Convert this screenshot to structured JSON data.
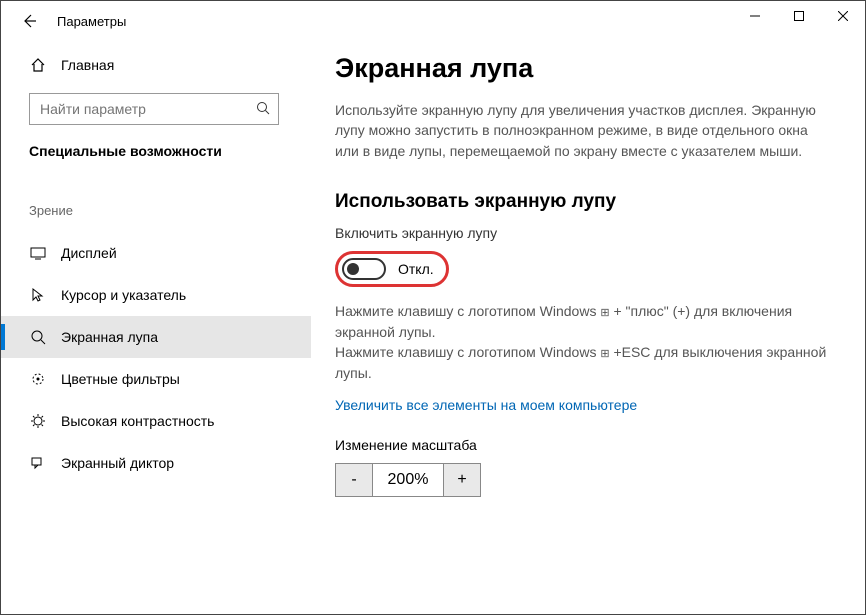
{
  "window": {
    "title": "Параметры"
  },
  "sidebar": {
    "home": "Главная",
    "search_placeholder": "Найти параметр",
    "category": "Специальные возможности",
    "subheader": "Зрение",
    "items": [
      {
        "label": "Дисплей"
      },
      {
        "label": "Курсор и указатель"
      },
      {
        "label": "Экранная лупа"
      },
      {
        "label": "Цветные фильтры"
      },
      {
        "label": "Высокая контрастность"
      },
      {
        "label": "Экранный диктор"
      }
    ]
  },
  "content": {
    "heading": "Экранная лупа",
    "desc": "Используйте экранную лупу для увеличения участков дисплея. Экранную лупу можно запустить в полноэкранном режиме, в виде отдельного окна или в виде лупы, перемещаемой по экрану вместе с указателем мыши.",
    "use_heading": "Использовать экранную лупу",
    "enable_label": "Включить экранную лупу",
    "toggle_state": "Откл.",
    "hint1a": "Нажмите клавишу с логотипом Windows ",
    "hint1b": " + \"плюс\" (+) для включения экранной лупы.",
    "hint2a": "Нажмите клавишу с логотипом Windows ",
    "hint2b": " +ESC для выключения экранной лупы.",
    "link": "Увеличить все элементы на моем компьютере",
    "zoom_label": "Изменение масштаба",
    "zoom_value": "200%"
  }
}
